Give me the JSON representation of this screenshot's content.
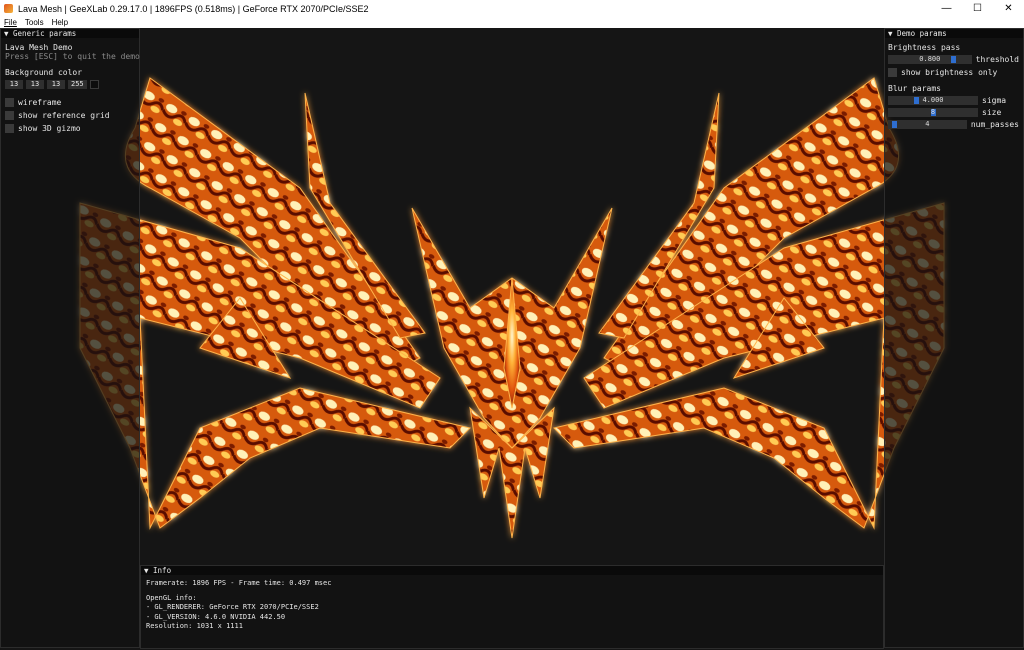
{
  "window": {
    "title": "Lava Mesh | GeeXLab 0.29.17.0 | 1896FPS (0.518ms) | GeForce RTX 2070/PCIe/SSE2",
    "minimize_glyph": "—",
    "maximize_glyph": "☐",
    "close_glyph": "✕"
  },
  "menu": [
    "File",
    "Tools",
    "Help"
  ],
  "colors": {
    "lava_bright": "#fff3c8",
    "lava_mid": "#ff8a14",
    "lava_dark": "#6a1500",
    "bg": "#151515",
    "slider_accent": "#2e6ed0"
  },
  "generic": {
    "header": "▼ Generic params",
    "demo_name": "Lava Mesh Demo",
    "hint": "Press [ESC] to quit the demo",
    "bg_label": "Background color",
    "bg_values": [
      "13",
      "13",
      "13",
      "255"
    ],
    "wireframe": "wireframe",
    "show_grid": "show reference grid",
    "show_gizmo": "show 3D gizmo"
  },
  "demo": {
    "header": "▼ Demo params",
    "brightness_title": "Brightness pass",
    "threshold_value": "0.800",
    "threshold_label": "threshold",
    "threshold_level": 0.8,
    "show_brightness": "show brightness only",
    "blur_title": "Blur params",
    "sigma_value": "4.000",
    "sigma_label": "sigma",
    "sigma_level": 0.3,
    "size_value": "8",
    "size_label": "size",
    "size_level": 0.5,
    "passes_value": "4",
    "passes_label": "num_passes",
    "passes_level": 0.05
  },
  "info": {
    "header": "▼ Info",
    "framerate": "Framerate: 1896 FPS - Frame time: 0.497 msec",
    "opengl_title": "OpenGL info:",
    "renderer": "- GL_RENDERER: GeForce RTX 2070/PCIe/SSE2",
    "version": "- GL_VERSION: 4.6.0 NVIDIA 442.50",
    "resolution": "Resolution: 1031 x 1111"
  }
}
